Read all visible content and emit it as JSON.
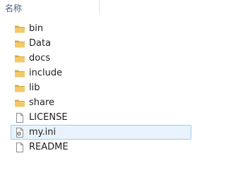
{
  "header": {
    "name_column": "名称"
  },
  "files": [
    {
      "name": "bin",
      "type": "folder",
      "icon": "folder-icon"
    },
    {
      "name": "Data",
      "type": "folder",
      "icon": "folder-icon"
    },
    {
      "name": "docs",
      "type": "folder",
      "icon": "folder-icon"
    },
    {
      "name": "include",
      "type": "folder",
      "icon": "folder-icon"
    },
    {
      "name": "lib",
      "type": "folder",
      "icon": "folder-icon"
    },
    {
      "name": "share",
      "type": "folder",
      "icon": "folder-icon"
    },
    {
      "name": "LICENSE",
      "type": "file",
      "icon": "document-icon"
    },
    {
      "name": "my.ini",
      "type": "config",
      "icon": "config-file-icon",
      "selected": true
    },
    {
      "name": "README",
      "type": "file",
      "icon": "document-icon"
    }
  ],
  "colors": {
    "folder": "#f2c96b",
    "folder_dark": "#d9a83e",
    "selection_fill": "#e8f3fd",
    "selection_border": "#a8cbed",
    "header_text": "#4c607a"
  }
}
